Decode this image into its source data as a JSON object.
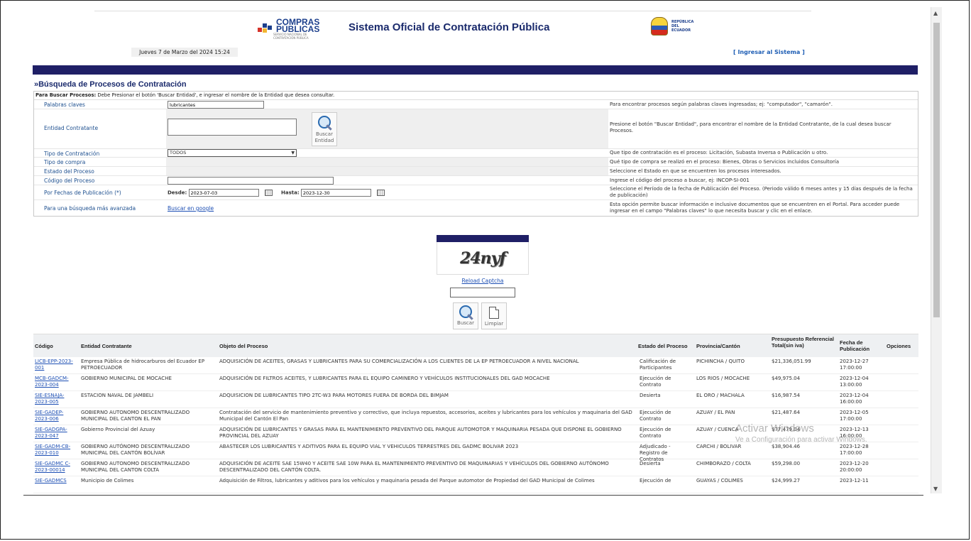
{
  "header": {
    "compras_logo_text": "COMPRAS PÚBLICAS",
    "compras_logo_sub": "SERVICIO NACIONAL DE CONTRATACIÓN PÚBLICA",
    "system_title": "Sistema Oficial de Contratación Pública",
    "republic_logo_text": "REPÚBLICA DEL ECUADOR",
    "datetime": "Jueves 7 de Marzo del 2024 15:24",
    "login_link": "[ Ingresar al Sistema ]"
  },
  "search": {
    "section_title": "»Búsqueda de Procesos de Contratación",
    "note_bold": "Para Buscar Procesos:",
    "note_text": " Debe Presionar el botón 'Buscar Entidad', e ingresar el nombre de la Entidad que desea consultar.",
    "keywords_label": "Palabras claves",
    "keywords_value": "lubricantes",
    "keywords_hint": "Para encontrar procesos según palabras claves ingresadas; ej: \"computador\", \"camarón\".",
    "entity_label": "Entidad Contratante",
    "entity_button": "Buscar Entidad",
    "entity_hint": "Presione el botón \"Buscar Entidad\", para encontrar el nombre de la Entidad Contratante, de la cual desea buscar Procesos.",
    "type_label": "Tipo de Contratación",
    "type_value": "TODOS",
    "type_hint": "Que tipo de contratación es el proceso: Licitación, Subasta Inversa o Publicación u otro.",
    "purchase_label": "Tipo de compra",
    "purchase_hint": "Qué tipo de compra se realizó en el proceso: Bienes, Obras o Servicios incluidos Consultoría",
    "state_label": "Estado del Proceso",
    "state_hint": "Seleccione el Estado en que se encuentren los procesos interesados.",
    "code_label": "Código del Proceso",
    "code_hint": "Ingrese el código del proceso a buscar, ej: INCOP-SI-001",
    "dates_label": "Por Fechas de Publicación (*)",
    "from_label": "Desde:",
    "from_value": "2023-07-03",
    "to_label": "Hasta:",
    "to_value": "2023-12-30",
    "dates_hint": "Seleccione el Período de la fecha de Publicación del Proceso. (Periodo válido 6 meses antes y 15 días después de la fecha de publicación)",
    "advanced_label": "Para una búsqueda más avanzada",
    "advanced_link": "Buscar en google",
    "advanced_hint": "Esta opción permite buscar información e inclusive documentos que se encuentren en el Portal. Para acceder puede ingresar en el campo \"Palabras claves\" lo que necesita buscar y clic en el enlace."
  },
  "captcha": {
    "text": "24nyf",
    "reload": "Reload Captcha",
    "search_button": "Buscar",
    "clear_button": "Limpiar"
  },
  "results": {
    "headers": [
      "Código",
      "Entidad Contratante",
      "Objeto del Proceso",
      "Estado del Proceso",
      "Provincia/Cantón",
      "Presupuesto Referencial Total(sin iva)",
      "Fecha de Publicación",
      "Opciones"
    ],
    "rows": [
      {
        "code": "LICB-EPP-2023-001",
        "entity": "Empresa Pública de hidrocarburos del Ecuador EP PETROECUADOR",
        "object": "ADQUISICIÓN DE ACEITES, GRASAS Y LUBRICANTES PARA SU COMERCIALIZACIÓN A LOS CLIENTES DE LA EP PETROECUADOR A NIVEL NACIONAL",
        "state": "Calificación de Participantes",
        "province": "PICHINCHA / QUITO",
        "budget": "$21,336,051.99",
        "date": "2023-12-27 17:00:00"
      },
      {
        "code": "MCB-GADCM-2023-004",
        "entity": "GOBIERNO MUNICIPAL DE MOCACHE",
        "object": "ADQUISICIÓN DE FILTROS ACEITES, Y LUBRICANTES PARA EL EQUIPO CAMINERO Y VEHÍCULOS INSTITUCIONALES DEL GAD MOCACHE",
        "state": "Ejecución de Contrato",
        "province": "LOS RIOS / MOCACHE",
        "budget": "$49,975.04",
        "date": "2023-12-04 13:00:00"
      },
      {
        "code": "SIE-ESNAJA-2023-005",
        "entity": "ESTACION NAVAL DE JAMBELI",
        "object": "ADQUISICION DE LUBRICANTES TIPO 2TC-W3 PARA MOTORES FUERA DE BORDA DEL BIMJAM",
        "state": "Desierta",
        "province": "EL ORO / MACHALA",
        "budget": "$16,987.54",
        "date": "2023-12-04 16:00:00"
      },
      {
        "code": "SIE-GADEP-2023-006",
        "entity": "GOBIERNO AUTONOMO DESCENTRALIZADO MUNICIPAL DEL CANTON EL PAN",
        "object": "Contratación del servicio de mantenimiento preventivo y correctivo, que incluya repuestos, accesorios, aceites y lubricantes para los vehículos y maquinaria del GAD Municipal del Cantón El Pan",
        "state": "Ejecución de Contrato",
        "province": "AZUAY / EL PAN",
        "budget": "$21,487.64",
        "date": "2023-12-05 17:00:00"
      },
      {
        "code": "SIE-GADGPA-2023-047",
        "entity": "Gobierno Provincial del Azuay",
        "object": "ADQUISICIÓN DE LUBRICANTES Y GRASAS PARA EL MANTENIMIENTO PREVENTIVO DEL PARQUE AUTOMOTOR Y MAQUINARIA PESADA QUE DISPONE EL GOBIERNO PROVINCIAL DEL AZUAY",
        "state": "Ejecución de Contrato",
        "province": "AZUAY / CUENCA",
        "budget": "$77,479.04",
        "date": "2023-12-13 16:00:00"
      },
      {
        "code": "SIE-GADM-CB-2023-010",
        "entity": "GOBIERNO AUTÓNOMO DESCENTRALIZADO MUNICIPAL DEL CANTÓN BOLÍVAR",
        "object": "ABASTECER LOS LUBRICANTES Y ADITIVOS PARA EL EQUIPO VIAL Y VEHICULOS TERRESTRES DEL GADMC BOLIVAR 2023",
        "state": "Adjudicado - Registro de Contratos",
        "province": "CARCHI / BOLIVAR",
        "budget": "$38,904.46",
        "date": "2023-12-28 17:00:00"
      },
      {
        "code": "SIE-GADMC C-2023-00014",
        "entity": "GOBIERNO AUTONOMO DESCENTRALIZADO MUNICIPAL DEL CANTON COLTA",
        "object": "ADQUISICIÓN DE ACEITE SAE 15W40 Y ACEITE SAE 10W PARA EL MANTENIMIENTO PREVENTIVO DE MAQUINARIAS Y VEHÍCULOS DEL GOBIERNO AUTÓNOMO DESCENTRALIZADO DEL CANTÓN COLTA.",
        "state": "Desierta",
        "province": "CHIMBORAZO / COLTA",
        "budget": "$59,298.00",
        "date": "2023-12-20 20:00:00"
      },
      {
        "code": "SIE-GADMCS",
        "entity": "Municipio de Colimes",
        "object": "Adquisición de Filtros, lubricantes y aditivos para los vehículos y maquinaria pesada del Parque automotor de Propiedad del GAD Municipal de Colimes",
        "state": "Ejecución de",
        "province": "GUAYAS / COLIMES",
        "budget": "$24,999.27",
        "date": "2023-12-11"
      }
    ]
  },
  "watermark": {
    "line1": "Activar Windows",
    "line2": "Ve a Configuración para activar Windows."
  },
  "colors": {
    "navy": "#1f1f66",
    "link": "#1d4fb4",
    "label": "#1d4f8f"
  }
}
